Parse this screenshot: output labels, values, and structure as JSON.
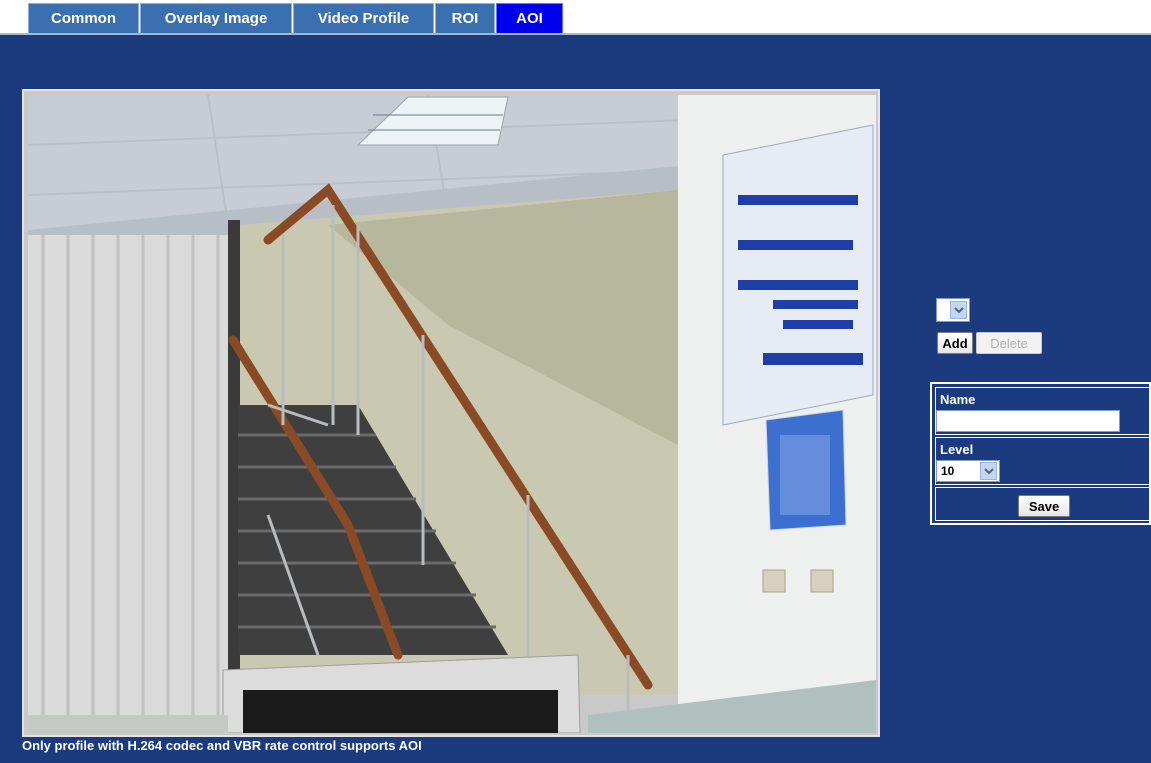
{
  "tabs": [
    {
      "label": "Common",
      "active": false
    },
    {
      "label": "Overlay Image",
      "active": false
    },
    {
      "label": "Video Profile",
      "active": false
    },
    {
      "label": "ROI",
      "active": false
    },
    {
      "label": "AOI",
      "active": true
    }
  ],
  "aoi": {
    "profile_select_value": "",
    "add_label": "Add",
    "delete_label": "Delete",
    "name_label": "Name",
    "name_value": "",
    "level_label": "Level",
    "level_value": "10",
    "save_label": "Save",
    "note": "Only profile with H.264 codec and VBR rate control supports AOI"
  },
  "colors": {
    "panel_bg": "#1c3a7e",
    "tab_bg": "#3a6fb0",
    "tab_active_bg": "#0000ee"
  }
}
